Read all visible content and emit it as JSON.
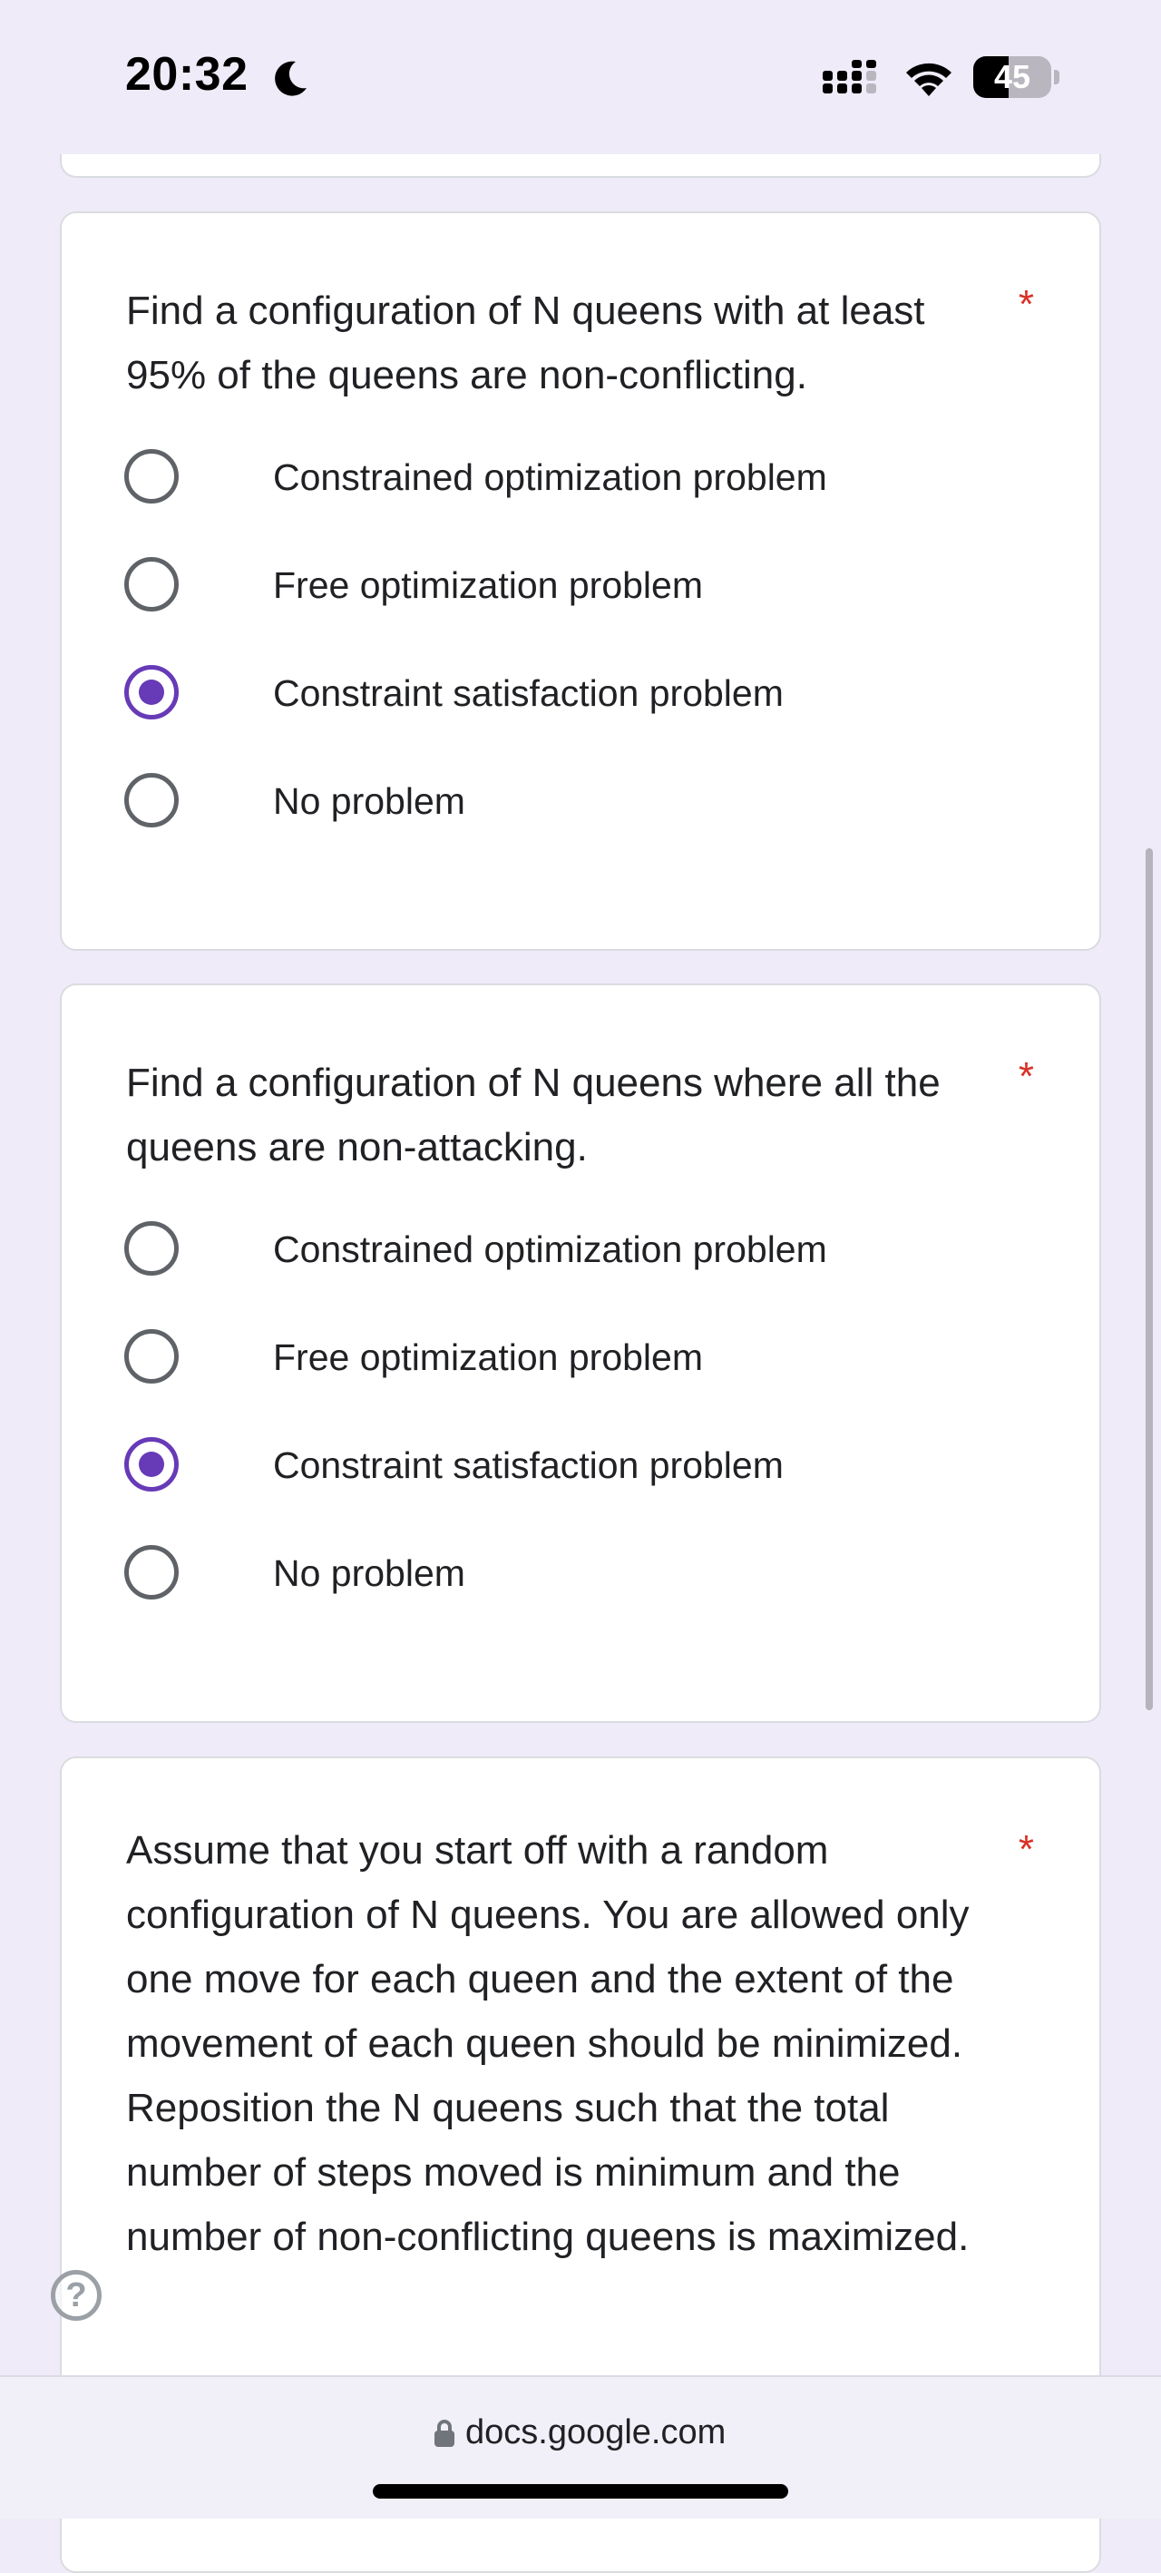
{
  "status_bar": {
    "time": "20:32",
    "battery_level": "45",
    "battery_fraction": 0.45
  },
  "questions": [
    {
      "text": "Find a configuration of N queens with at least 95% of the queens are non-conflicting.",
      "required_mark": "*",
      "options": [
        {
          "label": "Constrained optimization problem",
          "selected": false
        },
        {
          "label": "Free optimization problem",
          "selected": false
        },
        {
          "label": "Constraint satisfaction problem",
          "selected": true
        },
        {
          "label": "No problem",
          "selected": false
        }
      ]
    },
    {
      "text": "Find a configuration of N queens where all the queens are non-attacking.",
      "required_mark": "*",
      "options": [
        {
          "label": "Constrained optimization problem",
          "selected": false
        },
        {
          "label": "Free optimization problem",
          "selected": false
        },
        {
          "label": "Constraint satisfaction problem",
          "selected": true
        },
        {
          "label": "No problem",
          "selected": false
        }
      ]
    },
    {
      "text": "Assume that you start off with a random configuration of N queens.  You are allowed only one move for each queen and the extent of the movement of each queen should be minimized.  Reposition the N queens such that the total number of steps moved is minimum and the number of non-conflicting queens is maximized.",
      "required_mark": "*"
    }
  ],
  "help": {
    "icon": "help-icon",
    "glyph": "?"
  },
  "browser": {
    "url": "docs.google.com"
  },
  "colors": {
    "background": "#efebf8",
    "accent": "#673ab7",
    "required": "#d93025"
  }
}
